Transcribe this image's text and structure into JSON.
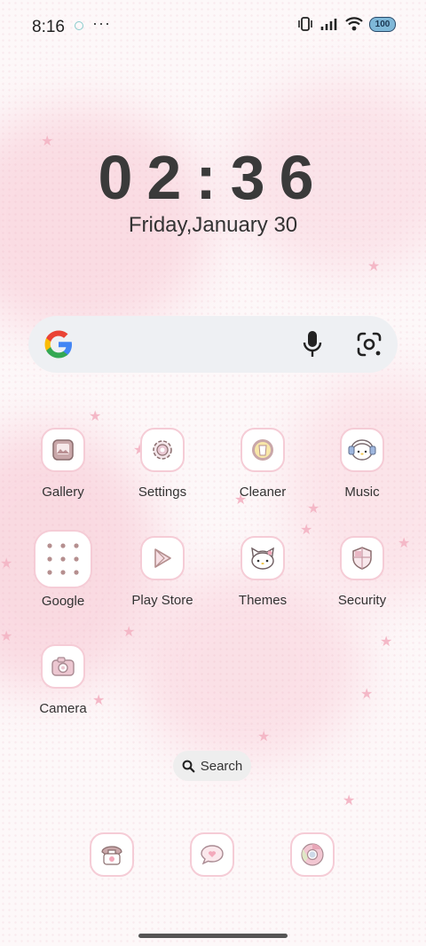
{
  "status": {
    "time": "8:16",
    "more": "···",
    "battery": "100"
  },
  "clock": {
    "time": "02:36",
    "date": "Friday,January 30"
  },
  "search": {
    "google_logo": "google-g-icon",
    "mic_icon": "microphone-icon",
    "lens_icon": "google-lens-icon"
  },
  "apps": [
    {
      "label": "Gallery",
      "icon": "gallery-icon"
    },
    {
      "label": "Settings",
      "icon": "gear-icon"
    },
    {
      "label": "Cleaner",
      "icon": "cleaner-icon"
    },
    {
      "label": "Music",
      "icon": "headphones-icon"
    },
    {
      "label": "Google",
      "icon": "folder-icon"
    },
    {
      "label": "Play Store",
      "icon": "play-store-icon"
    },
    {
      "label": "Themes",
      "icon": "kitty-face-icon"
    },
    {
      "label": "Security",
      "icon": "shield-icon"
    },
    {
      "label": "Camera",
      "icon": "camera-icon"
    }
  ],
  "app_search": {
    "label": "Search"
  },
  "dock": [
    {
      "icon": "phone-icon"
    },
    {
      "icon": "messages-icon"
    },
    {
      "icon": "chrome-icon"
    }
  ],
  "colors": {
    "accent_pink": "#f5ccd6",
    "icon_brown": "#b58f8f"
  }
}
